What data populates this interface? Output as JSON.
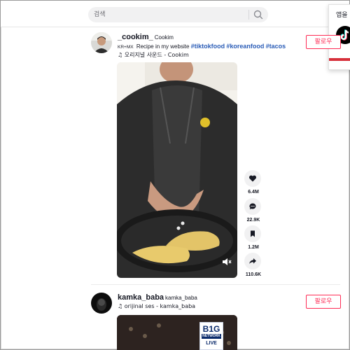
{
  "search": {
    "placeholder": "검색"
  },
  "app_popup": {
    "label": "앱을"
  },
  "posts": [
    {
      "username": "_cookim_",
      "nickname": "Cookim",
      "caption_prefix": "KR+MX",
      "caption_text": "Recipe in my website",
      "hashtags": [
        "#tiktokfood",
        "#koreanfood",
        "#tacos"
      ],
      "music": "오리지널 사운드 - Cookim",
      "follow_label": "팔로우",
      "likes": "6.4M",
      "comments": "22.9K",
      "saves": "1.2M",
      "shares": "110.6K"
    },
    {
      "username": "kamka_baba",
      "nickname": "kamka_baba",
      "music": "orijinal ses - kamka_baba",
      "follow_label": "팔로우",
      "video_badge_top": "B1G",
      "video_badge_bottom": "NETWORK",
      "video_badge_extra": "LIVE"
    }
  ],
  "colors": {
    "accent": "#fe2c55",
    "hashtag": "#2b5db7",
    "action_bg": "#f1f1f2"
  }
}
